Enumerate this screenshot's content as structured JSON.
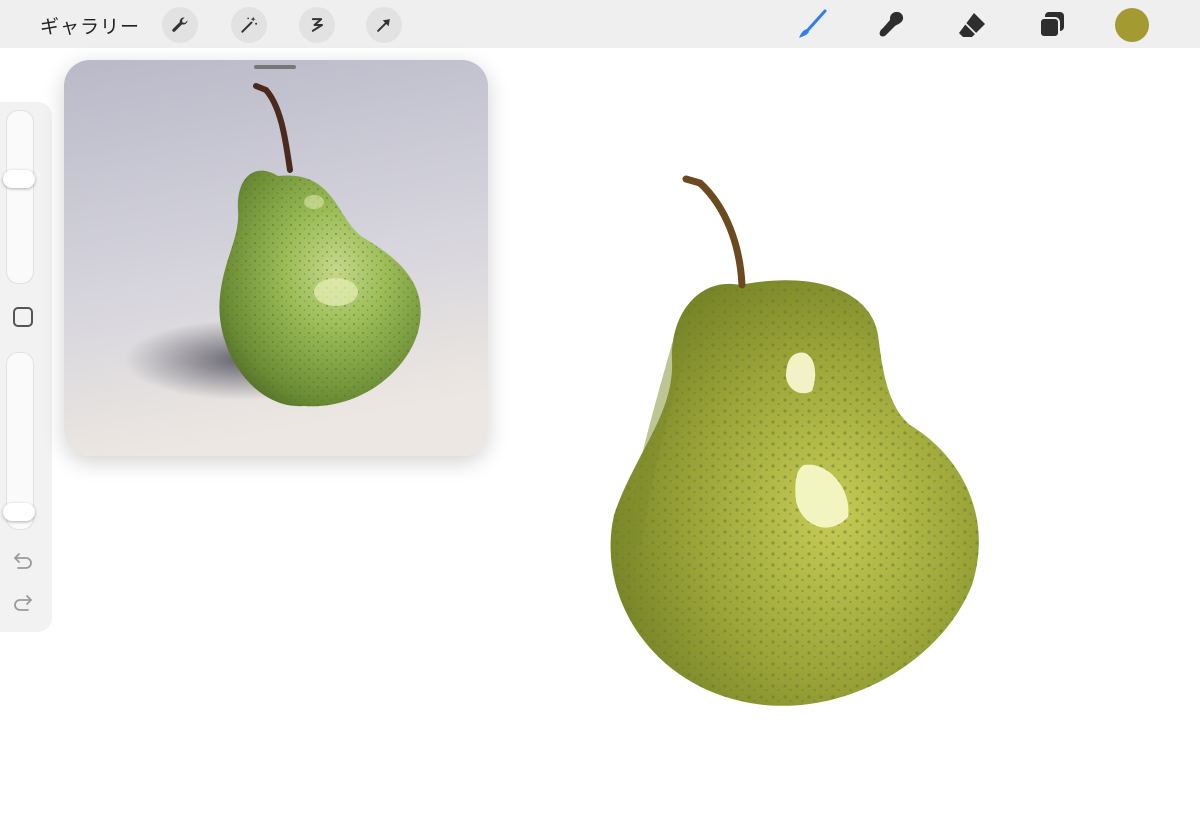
{
  "topbar": {
    "gallery_label": "ギャラリー",
    "left_tools": [
      "wrench-icon",
      "magic-wand-icon",
      "selection-s-icon",
      "transform-arrow-icon"
    ],
    "right_tools": [
      "brush-icon",
      "smudge-icon",
      "eraser-icon",
      "layers-icon"
    ],
    "active_tool": "brush-icon",
    "current_color": "#a39a31",
    "accent_color": "#2f7cf6"
  },
  "sidebar": {
    "brush_size_level": 0.62,
    "opacity_level": 0.05,
    "icons": [
      "modifier-square-icon",
      "undo-icon",
      "redo-icon"
    ]
  },
  "reference": {
    "subject": "pear-photo",
    "background_color": "#c9c9d4"
  },
  "canvas": {
    "subject": "pear-painting",
    "pear_color": "#9aa633"
  }
}
